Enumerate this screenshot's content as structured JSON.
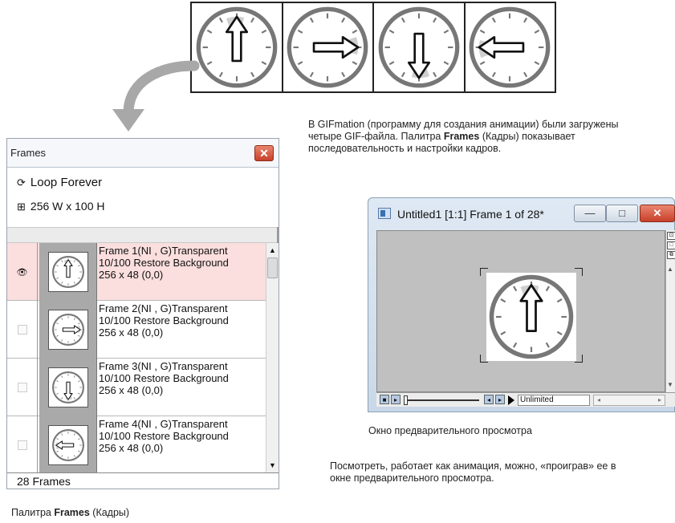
{
  "top_clocks": [
    "up",
    "right",
    "down",
    "left"
  ],
  "annotation_intro": {
    "pre": "В GIFmation (программу для создания анимации) были загружены четыре GIF-файла. Палитра ",
    "bold": "Frames",
    "post": " (Кадры) показывает последовательность и настройки кадров."
  },
  "frames_palette": {
    "title": "Frames",
    "close": "✕",
    "loop_icon": "refresh-icon",
    "loop": "Loop Forever",
    "size_icon": "dimensions-icon",
    "size": "256 W x 100 H",
    "rows": [
      {
        "line1": "Frame 1(NI , G)Transparent",
        "line2": "10/100 Restore Background",
        "line3": "256 x 48  (0,0)",
        "visible": true,
        "selected": true,
        "arrow": "up"
      },
      {
        "line1": "Frame 2(NI , G)Transparent",
        "line2": "10/100 Restore Background",
        "line3": "256 x 48  (0,0)",
        "visible": false,
        "selected": false,
        "arrow": "right"
      },
      {
        "line1": "Frame 3(NI , G)Transparent",
        "line2": "10/100 Restore Background",
        "line3": "256 x 48  (0,0)",
        "visible": false,
        "selected": false,
        "arrow": "down"
      },
      {
        "line1": "Frame 4(NI , G)Transparent",
        "line2": "10/100 Restore Background",
        "line3": "256 x 48  (0,0)",
        "visible": false,
        "selected": false,
        "arrow": "left"
      }
    ],
    "count": "28 Frames"
  },
  "palette_caption": {
    "pre": "Палитра ",
    "bold": "Frames",
    "post": " (Кадры)"
  },
  "preview_window": {
    "title": "Untitled1 [1:1] Frame 1 of 28*",
    "minimize": "—",
    "maximize": "□",
    "close": "✕",
    "loop_mode": "Unlimited"
  },
  "preview_caption": "Окно предварительного просмотра",
  "annotation_play": "Посмотреть, работает как анимация, можно, «проиграв» ее в окне предварительного просмотра.",
  "colors": {
    "selected_row": "#fbdede",
    "close_red": "#c8402a",
    "canvas_gray": "#c0c0c0"
  }
}
